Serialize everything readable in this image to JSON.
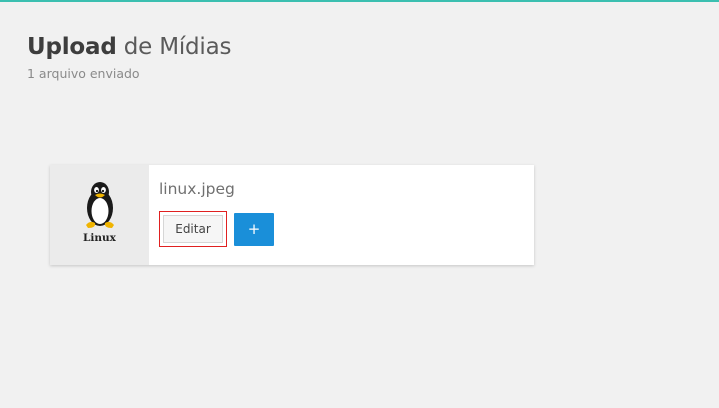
{
  "header": {
    "title_strong": "Upload",
    "title_rest": " de Mídias",
    "subtitle": "1 arquivo enviado"
  },
  "media": {
    "thumbnail_text": "Linux",
    "file_name": "linux.jpeg",
    "edit_label": "Editar",
    "add_label": "+"
  },
  "colors": {
    "accent": "#3bbfb0",
    "primary_button": "#1a8fd9",
    "highlight_border": "#e02020"
  },
  "icons": {
    "thumbnail": "tux-penguin-icon"
  }
}
